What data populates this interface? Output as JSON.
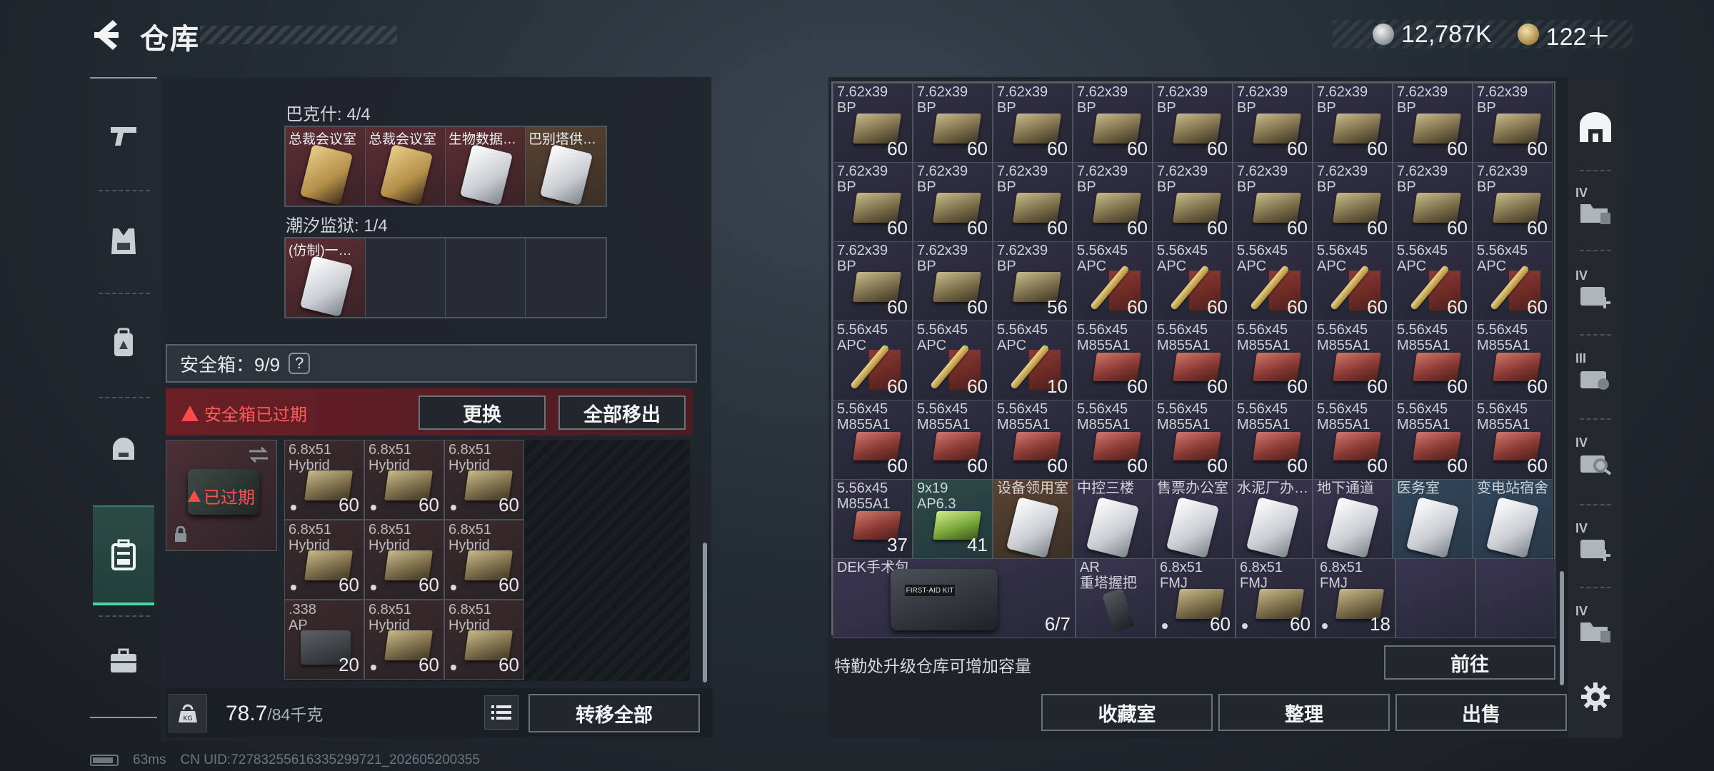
{
  "header": {
    "title": "仓库",
    "currency_silver": "12,787K",
    "currency_gold": "122＋"
  },
  "left": {
    "sets": [
      {
        "label": "巴克什: 4/4",
        "cells": [
          {
            "label": "总裁会议室",
            "style": "red",
            "card": "gold"
          },
          {
            "label": "总裁会议室",
            "style": "red",
            "card": "gold"
          },
          {
            "label": "生物数据…",
            "style": "red",
            "card": "white"
          },
          {
            "label": "巴别塔供…",
            "style": "brown",
            "card": "white"
          }
        ]
      },
      {
        "label": "潮汐监狱: 1/4",
        "cells": [
          {
            "label": "(仿制)一…",
            "style": "red",
            "card": "white"
          },
          {
            "label": "",
            "style": "empty",
            "card": ""
          },
          {
            "label": "",
            "style": "empty",
            "card": ""
          },
          {
            "label": "",
            "style": "empty",
            "card": ""
          }
        ]
      }
    ],
    "safe_label": "安全箱：9/9",
    "safe_help": "?",
    "expired_notice": "安全箱已过期",
    "replace_button": "更换",
    "move_all_out_button": "全部移出",
    "safe_box_status": "已过期",
    "secure_items": [
      {
        "name": "6.8x51\nHybrid",
        "qty": "60",
        "box": "olive"
      },
      {
        "name": "6.8x51\nHybrid",
        "qty": "60",
        "box": "olive"
      },
      {
        "name": "6.8x51\nHybrid",
        "qty": "60",
        "box": "olive"
      },
      {
        "name": "6.8x51\nHybrid",
        "qty": "60",
        "box": "olive"
      },
      {
        "name": "6.8x51\nHybrid",
        "qty": "60",
        "box": "olive"
      },
      {
        "name": "6.8x51\nHybrid",
        "qty": "60",
        "box": "olive"
      },
      {
        "name": ".338\nAP",
        "qty": "20",
        "box": "dark"
      },
      {
        "name": "6.8x51\nHybrid",
        "qty": "60",
        "box": "olive"
      },
      {
        "name": "6.8x51\nHybrid",
        "qty": "60",
        "box": "olive"
      }
    ],
    "weight_value": "78.7",
    "weight_max": "/84千克",
    "transfer_all_button": "转移全部"
  },
  "status": {
    "ping": "63ms",
    "uid": "CN UID:72783255616335299721_202605200355"
  },
  "warehouse": {
    "items": [
      {
        "name": "7.62x39\nBP",
        "qty": "60",
        "box": "olive",
        "bg": "ammo"
      },
      {
        "name": "7.62x39\nBP",
        "qty": "60",
        "box": "olive",
        "bg": "ammo"
      },
      {
        "name": "7.62x39\nBP",
        "qty": "60",
        "box": "olive",
        "bg": "ammo"
      },
      {
        "name": "7.62x39\nBP",
        "qty": "60",
        "box": "olive",
        "bg": "ammo"
      },
      {
        "name": "7.62x39\nBP",
        "qty": "60",
        "box": "olive",
        "bg": "ammo"
      },
      {
        "name": "7.62x39\nBP",
        "qty": "60",
        "box": "olive",
        "bg": "ammo"
      },
      {
        "name": "7.62x39\nBP",
        "qty": "60",
        "box": "olive",
        "bg": "ammo"
      },
      {
        "name": "7.62x39\nBP",
        "qty": "60",
        "box": "olive",
        "bg": "ammo"
      },
      {
        "name": "7.62x39\nBP",
        "qty": "60",
        "box": "olive",
        "bg": "ammo"
      },
      {
        "name": "7.62x39\nBP",
        "qty": "60",
        "box": "olive",
        "bg": "ammo"
      },
      {
        "name": "7.62x39\nBP",
        "qty": "60",
        "box": "olive",
        "bg": "ammo"
      },
      {
        "name": "7.62x39\nBP",
        "qty": "60",
        "box": "olive",
        "bg": "ammo"
      },
      {
        "name": "7.62x39\nBP",
        "qty": "60",
        "box": "olive",
        "bg": "ammo"
      },
      {
        "name": "7.62x39\nBP",
        "qty": "60",
        "box": "olive",
        "bg": "ammo"
      },
      {
        "name": "7.62x39\nBP",
        "qty": "60",
        "box": "olive",
        "bg": "ammo"
      },
      {
        "name": "7.62x39\nBP",
        "qty": "60",
        "box": "olive",
        "bg": "ammo"
      },
      {
        "name": "7.62x39\nBP",
        "qty": "60",
        "box": "olive",
        "bg": "ammo"
      },
      {
        "name": "7.62x39\nBP",
        "qty": "60",
        "box": "olive",
        "bg": "ammo"
      },
      {
        "name": "7.62x39\nBP",
        "qty": "60",
        "box": "olive",
        "bg": "ammo"
      },
      {
        "name": "7.62x39\nBP",
        "qty": "60",
        "box": "olive",
        "bg": "ammo"
      },
      {
        "name": "7.62x39\nBP",
        "qty": "56",
        "box": "olive",
        "bg": "ammo"
      },
      {
        "name": "5.56x45\nAPC",
        "qty": "60",
        "box": "bullet",
        "bg": "ammo"
      },
      {
        "name": "5.56x45\nAPC",
        "qty": "60",
        "box": "bullet",
        "bg": "ammo"
      },
      {
        "name": "5.56x45\nAPC",
        "qty": "60",
        "box": "bullet",
        "bg": "ammo"
      },
      {
        "name": "5.56x45\nAPC",
        "qty": "60",
        "box": "bullet",
        "bg": "ammo"
      },
      {
        "name": "5.56x45\nAPC",
        "qty": "60",
        "box": "bullet",
        "bg": "ammo"
      },
      {
        "name": "5.56x45\nAPC",
        "qty": "60",
        "box": "bullet",
        "bg": "ammo"
      },
      {
        "name": "5.56x45\nAPC",
        "qty": "60",
        "box": "bullet",
        "bg": "ammo"
      },
      {
        "name": "5.56x45\nAPC",
        "qty": "60",
        "box": "bullet",
        "bg": "ammo"
      },
      {
        "name": "5.56x45\nAPC",
        "qty": "10",
        "box": "bullet",
        "bg": "ammo"
      },
      {
        "name": "5.56x45\nM855A1",
        "qty": "60",
        "box": "red",
        "bg": "ammo"
      },
      {
        "name": "5.56x45\nM855A1",
        "qty": "60",
        "box": "red",
        "bg": "ammo"
      },
      {
        "name": "5.56x45\nM855A1",
        "qty": "60",
        "box": "red",
        "bg": "ammo"
      },
      {
        "name": "5.56x45\nM855A1",
        "qty": "60",
        "box": "red",
        "bg": "ammo"
      },
      {
        "name": "5.56x45\nM855A1",
        "qty": "60",
        "box": "red",
        "bg": "ammo"
      },
      {
        "name": "5.56x45\nM855A1",
        "qty": "60",
        "box": "red",
        "bg": "ammo"
      },
      {
        "name": "5.56x45\nM855A1",
        "qty": "60",
        "box": "red",
        "bg": "ammo"
      },
      {
        "name": "5.56x45\nM855A1",
        "qty": "60",
        "box": "red",
        "bg": "ammo"
      },
      {
        "name": "5.56x45\nM855A1",
        "qty": "60",
        "box": "red",
        "bg": "ammo"
      },
      {
        "name": "5.56x45\nM855A1",
        "qty": "60",
        "box": "red",
        "bg": "ammo"
      },
      {
        "name": "5.56x45\nM855A1",
        "qty": "60",
        "box": "red",
        "bg": "ammo"
      },
      {
        "name": "5.56x45\nM855A1",
        "qty": "60",
        "box": "red",
        "bg": "ammo"
      },
      {
        "name": "5.56x45\nM855A1",
        "qty": "60",
        "box": "red",
        "bg": "ammo"
      },
      {
        "name": "5.56x45\nM855A1",
        "qty": "60",
        "box": "red",
        "bg": "ammo"
      },
      {
        "name": "5.56x45\nM855A1",
        "qty": "60",
        "box": "red",
        "bg": "ammo"
      },
      {
        "name": "5.56x45\nM855A1",
        "qty": "37",
        "box": "red",
        "bg": "ammo"
      },
      {
        "name": "9x19\nAP6.3",
        "qty": "41",
        "box": "green",
        "bg": "green"
      },
      {
        "name": "设备领用室",
        "qty": "",
        "box": "card-white",
        "bg": "brown"
      },
      {
        "name": "中控三楼",
        "qty": "",
        "box": "card-white",
        "bg": "purple"
      },
      {
        "name": "售票办公室",
        "qty": "",
        "box": "card-white",
        "bg": "purple"
      },
      {
        "name": "水泥厂办…",
        "qty": "",
        "box": "card-white",
        "bg": "purple"
      },
      {
        "name": "地下通道",
        "qty": "",
        "box": "card-white",
        "bg": "purple"
      },
      {
        "name": "医务室",
        "qty": "",
        "box": "card-white",
        "bg": "blue"
      },
      {
        "name": "变电站宿舍",
        "qty": "",
        "box": "card-white",
        "bg": "blue"
      }
    ],
    "medkit": {
      "name": "DEK手术包",
      "qty": "6/7",
      "strap_label": "FIRST-AID KIT"
    },
    "grip": {
      "name": "AR\n重塔握把"
    },
    "fmj_items": [
      {
        "name": "6.8x51\nFMJ",
        "qty": "60"
      },
      {
        "name": "6.8x51\nFMJ",
        "qty": "60"
      },
      {
        "name": "6.8x51\nFMJ",
        "qty": "18"
      }
    ],
    "upgrade_note": "特勤处升级仓库可增加容量",
    "go_button": "前往",
    "collection_button": "收藏室",
    "sort_button": "整理",
    "sell_button": "出售"
  },
  "rail": {
    "tiers": [
      "IV",
      "IV",
      "III",
      "IV",
      "IV",
      "IV"
    ]
  },
  "colors": {
    "accent_green": "#46d6a8",
    "danger_red": "#ff4b4b"
  }
}
